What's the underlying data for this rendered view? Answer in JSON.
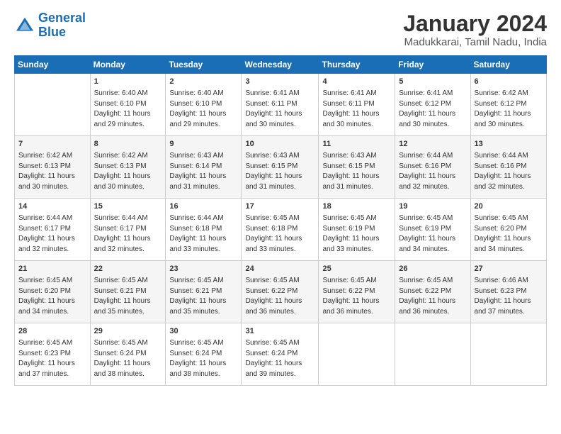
{
  "logo": {
    "line1": "General",
    "line2": "Blue"
  },
  "title": "January 2024",
  "location": "Madukkarai, Tamil Nadu, India",
  "days_of_week": [
    "Sunday",
    "Monday",
    "Tuesday",
    "Wednesday",
    "Thursday",
    "Friday",
    "Saturday"
  ],
  "weeks": [
    [
      {
        "day": "",
        "sunrise": "",
        "sunset": "",
        "daylight": ""
      },
      {
        "day": "1",
        "sunrise": "Sunrise: 6:40 AM",
        "sunset": "Sunset: 6:10 PM",
        "daylight": "Daylight: 11 hours and 29 minutes."
      },
      {
        "day": "2",
        "sunrise": "Sunrise: 6:40 AM",
        "sunset": "Sunset: 6:10 PM",
        "daylight": "Daylight: 11 hours and 29 minutes."
      },
      {
        "day": "3",
        "sunrise": "Sunrise: 6:41 AM",
        "sunset": "Sunset: 6:11 PM",
        "daylight": "Daylight: 11 hours and 30 minutes."
      },
      {
        "day": "4",
        "sunrise": "Sunrise: 6:41 AM",
        "sunset": "Sunset: 6:11 PM",
        "daylight": "Daylight: 11 hours and 30 minutes."
      },
      {
        "day": "5",
        "sunrise": "Sunrise: 6:41 AM",
        "sunset": "Sunset: 6:12 PM",
        "daylight": "Daylight: 11 hours and 30 minutes."
      },
      {
        "day": "6",
        "sunrise": "Sunrise: 6:42 AM",
        "sunset": "Sunset: 6:12 PM",
        "daylight": "Daylight: 11 hours and 30 minutes."
      }
    ],
    [
      {
        "day": "7",
        "sunrise": "Sunrise: 6:42 AM",
        "sunset": "Sunset: 6:13 PM",
        "daylight": "Daylight: 11 hours and 30 minutes."
      },
      {
        "day": "8",
        "sunrise": "Sunrise: 6:42 AM",
        "sunset": "Sunset: 6:13 PM",
        "daylight": "Daylight: 11 hours and 30 minutes."
      },
      {
        "day": "9",
        "sunrise": "Sunrise: 6:43 AM",
        "sunset": "Sunset: 6:14 PM",
        "daylight": "Daylight: 11 hours and 31 minutes."
      },
      {
        "day": "10",
        "sunrise": "Sunrise: 6:43 AM",
        "sunset": "Sunset: 6:15 PM",
        "daylight": "Daylight: 11 hours and 31 minutes."
      },
      {
        "day": "11",
        "sunrise": "Sunrise: 6:43 AM",
        "sunset": "Sunset: 6:15 PM",
        "daylight": "Daylight: 11 hours and 31 minutes."
      },
      {
        "day": "12",
        "sunrise": "Sunrise: 6:44 AM",
        "sunset": "Sunset: 6:16 PM",
        "daylight": "Daylight: 11 hours and 32 minutes."
      },
      {
        "day": "13",
        "sunrise": "Sunrise: 6:44 AM",
        "sunset": "Sunset: 6:16 PM",
        "daylight": "Daylight: 11 hours and 32 minutes."
      }
    ],
    [
      {
        "day": "14",
        "sunrise": "Sunrise: 6:44 AM",
        "sunset": "Sunset: 6:17 PM",
        "daylight": "Daylight: 11 hours and 32 minutes."
      },
      {
        "day": "15",
        "sunrise": "Sunrise: 6:44 AM",
        "sunset": "Sunset: 6:17 PM",
        "daylight": "Daylight: 11 hours and 32 minutes."
      },
      {
        "day": "16",
        "sunrise": "Sunrise: 6:44 AM",
        "sunset": "Sunset: 6:18 PM",
        "daylight": "Daylight: 11 hours and 33 minutes."
      },
      {
        "day": "17",
        "sunrise": "Sunrise: 6:45 AM",
        "sunset": "Sunset: 6:18 PM",
        "daylight": "Daylight: 11 hours and 33 minutes."
      },
      {
        "day": "18",
        "sunrise": "Sunrise: 6:45 AM",
        "sunset": "Sunset: 6:19 PM",
        "daylight": "Daylight: 11 hours and 33 minutes."
      },
      {
        "day": "19",
        "sunrise": "Sunrise: 6:45 AM",
        "sunset": "Sunset: 6:19 PM",
        "daylight": "Daylight: 11 hours and 34 minutes."
      },
      {
        "day": "20",
        "sunrise": "Sunrise: 6:45 AM",
        "sunset": "Sunset: 6:20 PM",
        "daylight": "Daylight: 11 hours and 34 minutes."
      }
    ],
    [
      {
        "day": "21",
        "sunrise": "Sunrise: 6:45 AM",
        "sunset": "Sunset: 6:20 PM",
        "daylight": "Daylight: 11 hours and 34 minutes."
      },
      {
        "day": "22",
        "sunrise": "Sunrise: 6:45 AM",
        "sunset": "Sunset: 6:21 PM",
        "daylight": "Daylight: 11 hours and 35 minutes."
      },
      {
        "day": "23",
        "sunrise": "Sunrise: 6:45 AM",
        "sunset": "Sunset: 6:21 PM",
        "daylight": "Daylight: 11 hours and 35 minutes."
      },
      {
        "day": "24",
        "sunrise": "Sunrise: 6:45 AM",
        "sunset": "Sunset: 6:22 PM",
        "daylight": "Daylight: 11 hours and 36 minutes."
      },
      {
        "day": "25",
        "sunrise": "Sunrise: 6:45 AM",
        "sunset": "Sunset: 6:22 PM",
        "daylight": "Daylight: 11 hours and 36 minutes."
      },
      {
        "day": "26",
        "sunrise": "Sunrise: 6:45 AM",
        "sunset": "Sunset: 6:22 PM",
        "daylight": "Daylight: 11 hours and 36 minutes."
      },
      {
        "day": "27",
        "sunrise": "Sunrise: 6:46 AM",
        "sunset": "Sunset: 6:23 PM",
        "daylight": "Daylight: 11 hours and 37 minutes."
      }
    ],
    [
      {
        "day": "28",
        "sunrise": "Sunrise: 6:45 AM",
        "sunset": "Sunset: 6:23 PM",
        "daylight": "Daylight: 11 hours and 37 minutes."
      },
      {
        "day": "29",
        "sunrise": "Sunrise: 6:45 AM",
        "sunset": "Sunset: 6:24 PM",
        "daylight": "Daylight: 11 hours and 38 minutes."
      },
      {
        "day": "30",
        "sunrise": "Sunrise: 6:45 AM",
        "sunset": "Sunset: 6:24 PM",
        "daylight": "Daylight: 11 hours and 38 minutes."
      },
      {
        "day": "31",
        "sunrise": "Sunrise: 6:45 AM",
        "sunset": "Sunset: 6:24 PM",
        "daylight": "Daylight: 11 hours and 39 minutes."
      },
      {
        "day": "",
        "sunrise": "",
        "sunset": "",
        "daylight": ""
      },
      {
        "day": "",
        "sunrise": "",
        "sunset": "",
        "daylight": ""
      },
      {
        "day": "",
        "sunrise": "",
        "sunset": "",
        "daylight": ""
      }
    ]
  ]
}
